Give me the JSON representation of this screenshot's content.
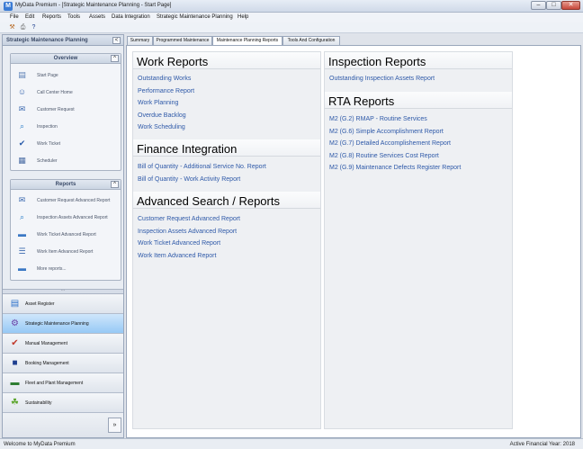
{
  "window": {
    "title": "MyData Premium - [Strategic Maintenance Planning - Start Page]",
    "controls": {
      "minimize": "–",
      "maximize": "□",
      "close": "✕"
    }
  },
  "menu": [
    "File",
    "Edit",
    "Reports",
    "Tools",
    "Assets",
    "Data Integration",
    "Strategic Maintenance Planning",
    "Help"
  ],
  "toolbar": {
    "icons": [
      "tools-icon",
      "print-icon",
      "help-pointer-icon"
    ]
  },
  "left_pane": {
    "header": "Strategic Maintenance Planning",
    "collapse_glyph": "<",
    "overview": {
      "title": "Overview",
      "toggle": "^",
      "items": [
        {
          "label": "Start Page",
          "icon": "start-page-icon",
          "glyph": "▤"
        },
        {
          "label": "Call Center Home",
          "icon": "user-icon",
          "glyph": "☺"
        },
        {
          "label": "Customer Request",
          "icon": "customer-request-icon",
          "glyph": "✉"
        },
        {
          "label": "Inspection",
          "icon": "magnifier-icon",
          "glyph": "⌕"
        },
        {
          "label": "Work Ticket",
          "icon": "ticket-icon",
          "glyph": "✔"
        },
        {
          "label": "Scheduler",
          "icon": "calendar-icon",
          "glyph": "▦"
        }
      ]
    },
    "reports": {
      "title": "Reports",
      "toggle": "^",
      "items": [
        {
          "label": "Customer Request Advanced Report",
          "icon": "customer-report-icon",
          "glyph": "✉"
        },
        {
          "label": "Inspection Assets Advanced Report",
          "icon": "inspection-report-icon",
          "glyph": "⌕"
        },
        {
          "label": "Work Ticket Advanced Report",
          "icon": "folder-icon",
          "glyph": "▬"
        },
        {
          "label": "Work Item Advanced Report",
          "icon": "list-icon",
          "glyph": "☰"
        },
        {
          "label": "More reports...",
          "icon": "more-reports-icon",
          "glyph": "▬"
        }
      ]
    },
    "splitter_glyph": "···",
    "nav": [
      {
        "label": "Asset Register",
        "icon": "asset-register-icon",
        "glyph": "▤",
        "color": "#2a6fc9"
      },
      {
        "label": "Strategic Maintenance Planning",
        "icon": "gear-globe-icon",
        "glyph": "⚙",
        "color": "#6a3fa6"
      },
      {
        "label": "Manual Management",
        "icon": "checklist-icon",
        "glyph": "✔",
        "color": "#c0392b"
      },
      {
        "label": "Booking Management",
        "icon": "booking-icon",
        "glyph": "■",
        "color": "#1f3f8f"
      },
      {
        "label": "Fleet and Plant Management",
        "icon": "vehicle-icon",
        "glyph": "▬",
        "color": "#2e7d32"
      },
      {
        "label": "Sustainability",
        "icon": "leaf-icon",
        "glyph": "☘",
        "color": "#5aa52a"
      }
    ],
    "more_glyph": "»"
  },
  "tabs": [
    {
      "label": "Summary",
      "active": false
    },
    {
      "label": "Programmed Maintenance",
      "active": false
    },
    {
      "label": "Maintenance Planning Reports",
      "active": true
    },
    {
      "label": "Tools And Configuration",
      "active": false
    }
  ],
  "content": {
    "left": [
      {
        "title": "Work Reports",
        "links": [
          "Outstanding Works",
          "Performance Report",
          "Work Planning",
          "Overdue Backlog",
          "Work Scheduling"
        ]
      },
      {
        "title": "Finance Integration",
        "links": [
          "Bill of Quantity - Additional Service No. Report",
          "Bill of Quantity - Work Activity Report"
        ]
      },
      {
        "title": "Advanced Search / Reports",
        "links": [
          "Customer Request Advanced Report",
          "Inspection Assets Advanced Report",
          "Work Ticket Advanced Report",
          "Work Item Advanced Report"
        ]
      }
    ],
    "right": [
      {
        "title": "Inspection Reports",
        "links": [
          "Outstanding Inspection Assets Report"
        ]
      },
      {
        "title": "RTA Reports",
        "links": [
          "M2 (G.2) RMAP - Routine Services",
          "M2 (G.6) Simple Accomplishment Report",
          "M2 (G.7) Detailed Accomplishement Report",
          "M2 (G.8) Routine Services Cost Report",
          "M2 (G.9) Maintenance Defects Register Report"
        ]
      }
    ]
  },
  "status": {
    "left": "Welcome to MyData Premium",
    "right": "Active Financial Year: 2018"
  }
}
